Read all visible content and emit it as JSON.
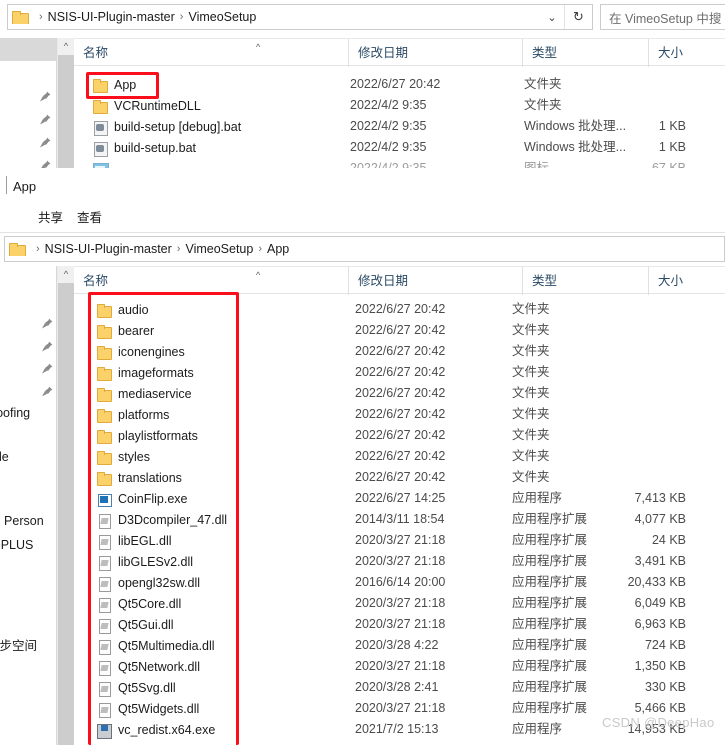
{
  "window_top": {
    "address_bar": {
      "folder_icon": "folder-icon",
      "crumbs": [
        "NSIS-UI-Plugin-master",
        "VimeoSetup"
      ],
      "separator": "›",
      "chevron_icon": "chevron-down-icon",
      "refresh_icon": "refresh-icon"
    },
    "search": {
      "placeholder": "在 VimeoSetup 中搜",
      "icon": "search-icon"
    },
    "columns": [
      "名称",
      "修改日期",
      "类型",
      "大小"
    ],
    "sort_indicator": "^",
    "scroll_up_icon": "^",
    "rows": [
      {
        "name": "App",
        "icon": "folder-icon",
        "date": "2022/6/27 20:42",
        "type": "文件夹",
        "size": ""
      },
      {
        "name": "VCRuntimeDLL",
        "icon": "folder-icon",
        "date": "2022/4/2 9:35",
        "type": "文件夹",
        "size": ""
      },
      {
        "name": "build-setup [debug].bat",
        "icon": "bat-icon",
        "date": "2022/4/2 9:35",
        "type": "Windows 批处理...",
        "size": "1 KB"
      },
      {
        "name": "build-setup.bat",
        "icon": "bat-icon",
        "date": "2022/4/2 9:35",
        "type": "Windows 批处理...",
        "size": "1 KB"
      },
      {
        "name": "",
        "icon": "image-icon",
        "date": "2022/4/2 9:35",
        "type": "图标",
        "size": "67 KB"
      }
    ],
    "nav_pins": [
      "pin-icon",
      "pin-icon",
      "pin-icon",
      "pin-icon"
    ]
  },
  "window_bottom": {
    "title": "App",
    "ribbon_tabs": [
      "共享",
      "查看"
    ],
    "address_bar": {
      "folder_icon": "folder-icon",
      "crumbs": [
        "NSIS-UI-Plugin-master",
        "VimeoSetup",
        "App"
      ],
      "separator": "›"
    },
    "columns": [
      "名称",
      "修改日期",
      "类型",
      "大小"
    ],
    "sort_indicator": "^",
    "scroll_up_icon": "^",
    "nav_pins": [
      "pin-icon",
      "pin-icon",
      "pin-icon",
      "pin-icon"
    ],
    "nav_items": [
      "iSpoofing",
      "ble",
      "e - Person",
      "fficePLUS",
      "同步空间"
    ],
    "rows": [
      {
        "name": "audio",
        "icon": "folder-icon",
        "date": "2022/6/27 20:42",
        "type": "文件夹",
        "size": ""
      },
      {
        "name": "bearer",
        "icon": "folder-icon",
        "date": "2022/6/27 20:42",
        "type": "文件夹",
        "size": ""
      },
      {
        "name": "iconengines",
        "icon": "folder-icon",
        "date": "2022/6/27 20:42",
        "type": "文件夹",
        "size": ""
      },
      {
        "name": "imageformats",
        "icon": "folder-icon",
        "date": "2022/6/27 20:42",
        "type": "文件夹",
        "size": ""
      },
      {
        "name": "mediaservice",
        "icon": "folder-icon",
        "date": "2022/6/27 20:42",
        "type": "文件夹",
        "size": ""
      },
      {
        "name": "platforms",
        "icon": "folder-icon",
        "date": "2022/6/27 20:42",
        "type": "文件夹",
        "size": ""
      },
      {
        "name": "playlistformats",
        "icon": "folder-icon",
        "date": "2022/6/27 20:42",
        "type": "文件夹",
        "size": ""
      },
      {
        "name": "styles",
        "icon": "folder-icon",
        "date": "2022/6/27 20:42",
        "type": "文件夹",
        "size": ""
      },
      {
        "name": "translations",
        "icon": "folder-icon",
        "date": "2022/6/27 20:42",
        "type": "文件夹",
        "size": ""
      },
      {
        "name": "CoinFlip.exe",
        "icon": "exe-icon",
        "date": "2022/6/27 14:25",
        "type": "应用程序",
        "size": "7,413 KB"
      },
      {
        "name": "D3Dcompiler_47.dll",
        "icon": "dll-icon",
        "date": "2014/3/11 18:54",
        "type": "应用程序扩展",
        "size": "4,077 KB"
      },
      {
        "name": "libEGL.dll",
        "icon": "dll-icon",
        "date": "2020/3/27 21:18",
        "type": "应用程序扩展",
        "size": "24 KB"
      },
      {
        "name": "libGLESv2.dll",
        "icon": "dll-icon",
        "date": "2020/3/27 21:18",
        "type": "应用程序扩展",
        "size": "3,491 KB"
      },
      {
        "name": "opengl32sw.dll",
        "icon": "dll-icon",
        "date": "2016/6/14 20:00",
        "type": "应用程序扩展",
        "size": "20,433 KB"
      },
      {
        "name": "Qt5Core.dll",
        "icon": "dll-icon",
        "date": "2020/3/27 21:18",
        "type": "应用程序扩展",
        "size": "6,049 KB"
      },
      {
        "name": "Qt5Gui.dll",
        "icon": "dll-icon",
        "date": "2020/3/27 21:18",
        "type": "应用程序扩展",
        "size": "6,963 KB"
      },
      {
        "name": "Qt5Multimedia.dll",
        "icon": "dll-icon",
        "date": "2020/3/28 4:22",
        "type": "应用程序扩展",
        "size": "724 KB"
      },
      {
        "name": "Qt5Network.dll",
        "icon": "dll-icon",
        "date": "2020/3/27 21:18",
        "type": "应用程序扩展",
        "size": "1,350 KB"
      },
      {
        "name": "Qt5Svg.dll",
        "icon": "dll-icon",
        "date": "2020/3/28 2:41",
        "type": "应用程序扩展",
        "size": "330 KB"
      },
      {
        "name": "Qt5Widgets.dll",
        "icon": "dll-icon",
        "date": "2020/3/27 21:18",
        "type": "应用程序扩展",
        "size": "5,466 KB"
      },
      {
        "name": "vc_redist.x64.exe",
        "icon": "vcredist-icon",
        "date": "2021/7/2 15:13",
        "type": "应用程序",
        "size": "14,953 KB"
      }
    ]
  },
  "annotations": {
    "highlight_color": "#fc0d1b",
    "boxes": [
      {
        "name": "app-folder-highlight"
      },
      {
        "name": "app-contents-highlight"
      }
    ]
  },
  "watermark": {
    "text": "CSDN @DeepHao"
  }
}
